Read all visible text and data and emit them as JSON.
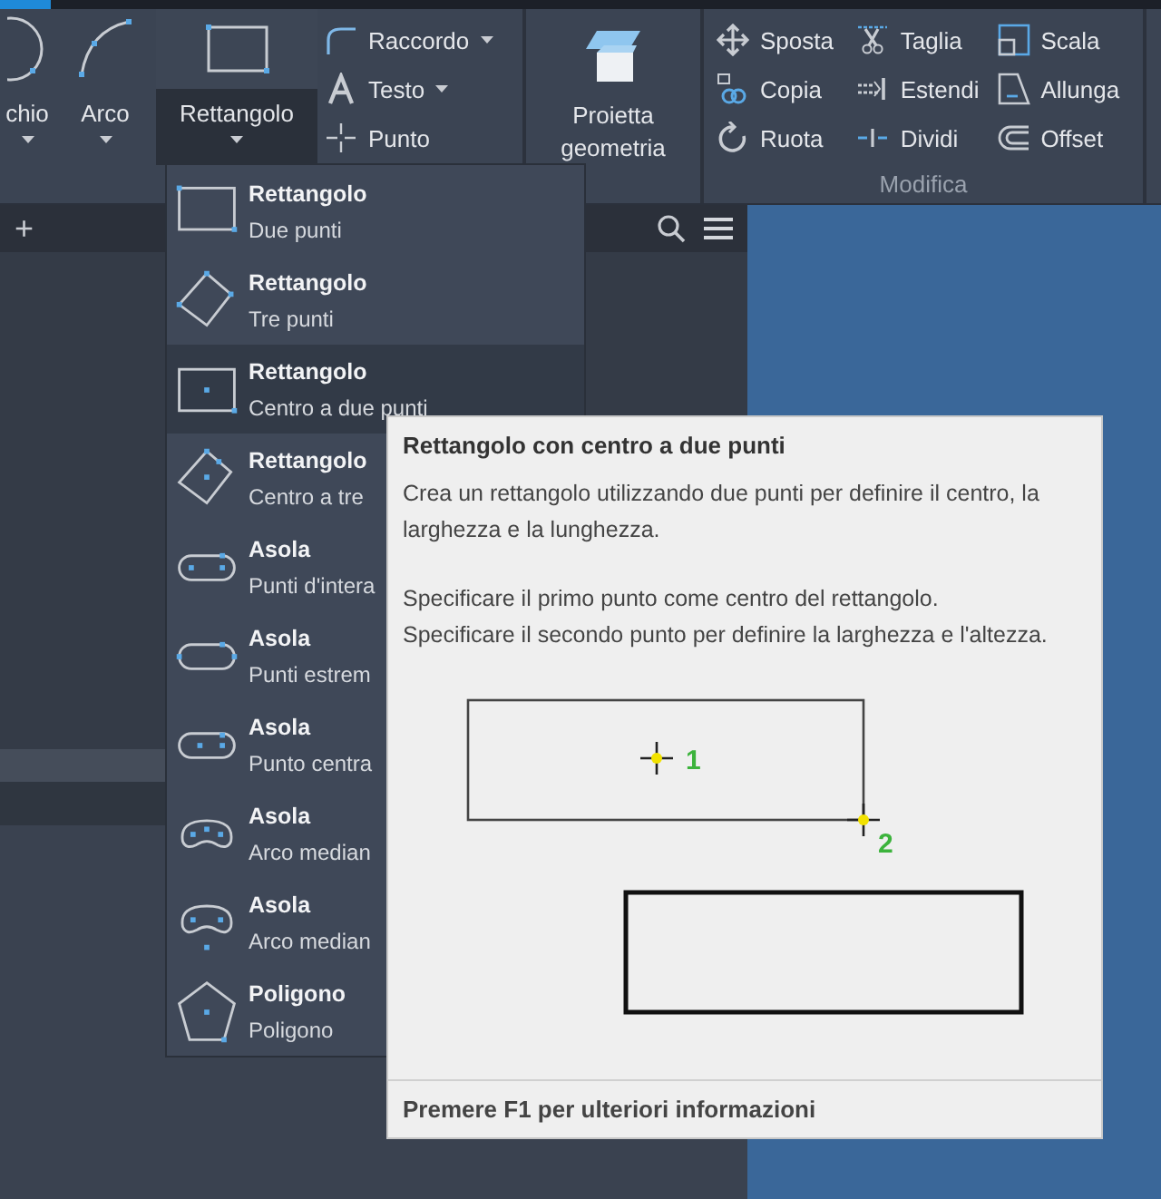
{
  "ribbon": {
    "big_tools": [
      {
        "label": "chio",
        "kind": "circle",
        "expanded": false
      },
      {
        "label": "Arco",
        "kind": "arc",
        "expanded": false
      },
      {
        "label": "Rettangolo",
        "kind": "rectangle",
        "expanded": true
      }
    ],
    "small_tools": [
      {
        "label": "Raccordo",
        "kind": "fillet",
        "has_menu": true
      },
      {
        "label": "Testo",
        "kind": "text",
        "has_menu": true
      },
      {
        "label": "Punto",
        "kind": "point",
        "has_menu": false
      }
    ],
    "project_button": {
      "label": "Proietta geometria"
    },
    "modify_panel": {
      "title": "Modifica",
      "columns": [
        [
          {
            "label": "Sposta",
            "kind": "move"
          },
          {
            "label": "Copia",
            "kind": "copy"
          },
          {
            "label": "Ruota",
            "kind": "rotate"
          }
        ],
        [
          {
            "label": "Taglia",
            "kind": "trim"
          },
          {
            "label": "Estendi",
            "kind": "extend"
          },
          {
            "label": "Dividi",
            "kind": "break"
          }
        ],
        [
          {
            "label": "Scala",
            "kind": "scale"
          },
          {
            "label": "Allunga",
            "kind": "stretch"
          },
          {
            "label": "Offset",
            "kind": "offset"
          }
        ]
      ]
    }
  },
  "tab_bar": {
    "add_label": "+"
  },
  "dropdown": {
    "items": [
      {
        "title": "Rettangolo",
        "subtitle": "Due punti",
        "kind": "rect-two",
        "selected": false
      },
      {
        "title": "Rettangolo",
        "subtitle": "Tre punti",
        "kind": "rect-three",
        "selected": false
      },
      {
        "title": "Rettangolo",
        "subtitle": "Centro a due punti",
        "kind": "rect-center-two",
        "selected": true
      },
      {
        "title": "Rettangolo",
        "subtitle": "Centro a tre",
        "kind": "rect-center-three",
        "selected": false
      },
      {
        "title": "Asola",
        "subtitle": "Punti d'intera",
        "kind": "slot-overall",
        "selected": false
      },
      {
        "title": "Asola",
        "subtitle": "Punti estrem",
        "kind": "slot-ends",
        "selected": false
      },
      {
        "title": "Asola",
        "subtitle": "Punto centra",
        "kind": "slot-center",
        "selected": false
      },
      {
        "title": "Asola",
        "subtitle": "Arco median",
        "kind": "arc-slot-three",
        "selected": false
      },
      {
        "title": "Asola",
        "subtitle": "Arco median",
        "kind": "arc-slot-center",
        "selected": false
      },
      {
        "title": "Poligono",
        "subtitle": "Poligono",
        "kind": "polygon",
        "selected": false
      }
    ]
  },
  "tooltip": {
    "title": "Rettangolo con centro a due punti",
    "description": "Crea un rettangolo utilizzando due punti per definire il centro, la larghezza e la lunghezza.",
    "instructions": [
      "Specificare il primo punto come centro del rettangolo.",
      "Specificare il secondo punto per definire la larghezza e l'altezza."
    ],
    "point_labels": [
      "1",
      "2"
    ],
    "footer": "Premere F1 per ulteriori informazioni"
  }
}
